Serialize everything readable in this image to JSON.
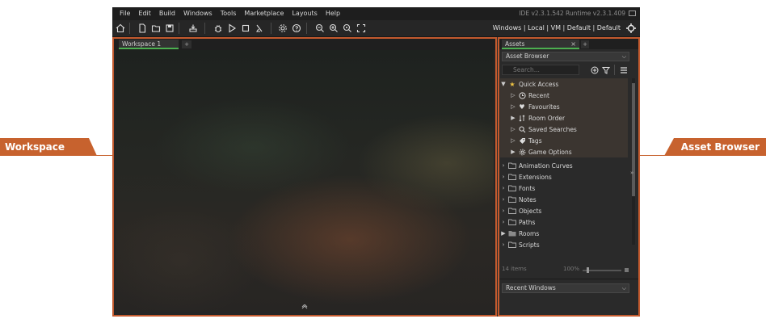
{
  "menu": [
    "File",
    "Edit",
    "Build",
    "Windows",
    "Tools",
    "Marketplace",
    "Layouts",
    "Help"
  ],
  "version": "IDE v2.3.1.542  Runtime v2.3.1.409",
  "toolbar": {
    "icons": [
      "home-icon",
      "new-project-icon",
      "open-icon",
      "save-icon",
      "create-executable-icon",
      "debug-icon",
      "run-icon",
      "stop-icon",
      "clean-icon",
      "game-options-icon",
      "help-icon",
      "zoom-out-icon",
      "zoom-in-icon",
      "zoom-reset-icon",
      "fullscreen-icon"
    ],
    "target": "Windows | Local | VM | Default | Default"
  },
  "workspace": {
    "tab_label": "Workspace 1",
    "add_tab": "+",
    "collapse": "»"
  },
  "assets": {
    "tab_label": "Assets",
    "close": "×",
    "add_tab": "+",
    "dropdown": "Asset Browser",
    "search_placeholder": "Search...",
    "quick_access_label": "Quick Access",
    "quick_access": [
      {
        "label": "Recent",
        "icon": "recent-icon"
      },
      {
        "label": "Favourites",
        "icon": "heart-icon"
      },
      {
        "label": "Room Order",
        "icon": "room-order-icon"
      },
      {
        "label": "Saved Searches",
        "icon": "saved-search-icon"
      },
      {
        "label": "Tags",
        "icon": "tag-icon"
      },
      {
        "label": "Game Options",
        "icon": "gear-icon"
      }
    ],
    "folders": [
      "Animation Curves",
      "Extensions",
      "Fonts",
      "Notes",
      "Objects",
      "Paths",
      "Rooms",
      "Scripts"
    ],
    "items_count": "14 items",
    "zoom": "100%",
    "recent_windows": "Recent Windows"
  },
  "callouts": {
    "left": "Workspace",
    "right": "Asset Browser"
  },
  "colors": {
    "accent": "#c7622e",
    "tab_underline": "#4caf50",
    "star": "#f2c744"
  }
}
